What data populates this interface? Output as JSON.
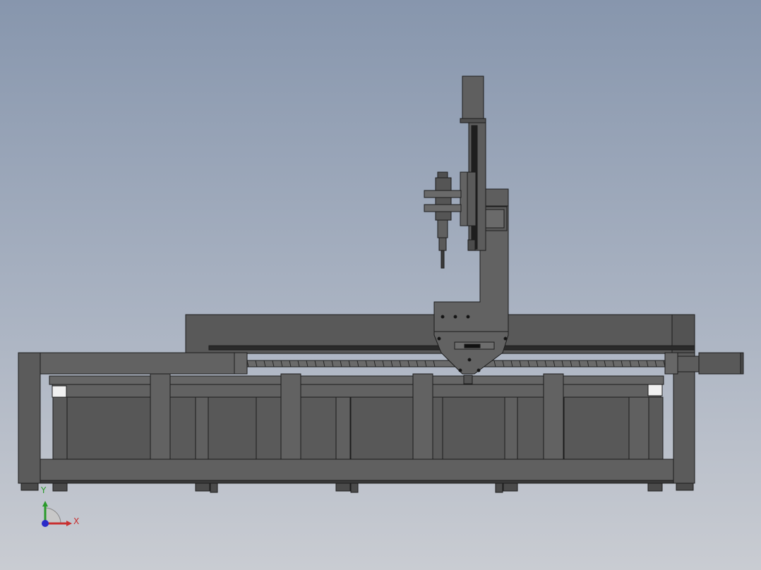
{
  "viewport": {
    "background_top": "#8796ad",
    "background_bottom": "#c9ccd2"
  },
  "model": {
    "fill": "#5e5e5e",
    "edge": "#1c1c1c"
  },
  "triad": {
    "x_label": "X",
    "y_label": "Y",
    "x_color": "#c83030",
    "y_color": "#2a9a2a",
    "z_color": "#2b2bc8"
  }
}
